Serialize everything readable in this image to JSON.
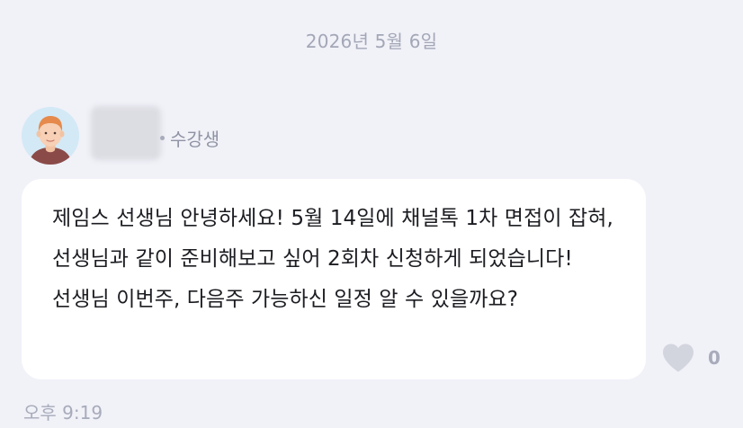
{
  "date_divider": "2026년 5월 6일",
  "message": {
    "sender_role": "수강생",
    "text": "제임스 선생님 안녕하세요! 5월 14일에 채널톡 1차 면접이 잡혀, 선생님과 같이 준비해보고 싶어 2회차 신청하게 되었습니다! 선생님 이번주, 다음주 가능하신 일정 알 수 있을까요?",
    "time": "오후 9:19",
    "like_count": "0"
  },
  "icons": {
    "avatar": "avatar-illustration",
    "like": "heart-icon"
  },
  "colors": {
    "background": "#f1f1f8",
    "bubble": "#ffffff",
    "muted_text": "#a7abba",
    "heart": "#d3d5de"
  }
}
